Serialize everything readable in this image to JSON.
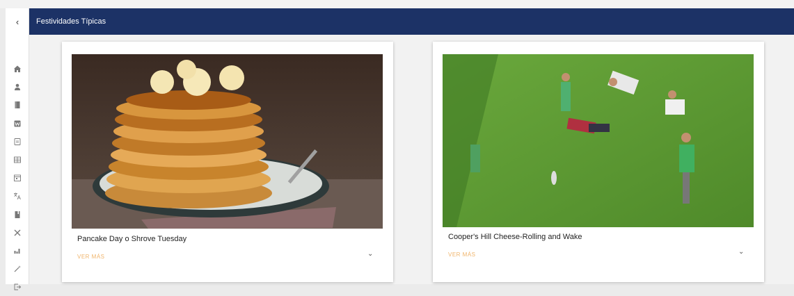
{
  "app": {
    "title": "Festividades Típicas"
  },
  "sidebar": {
    "collapse_icon": "‹",
    "items": [
      {
        "name": "home-icon"
      },
      {
        "name": "user-icon"
      },
      {
        "name": "book-icon"
      },
      {
        "name": "word-icon"
      },
      {
        "name": "document-icon"
      },
      {
        "name": "table-icon"
      },
      {
        "name": "calendar-icon"
      },
      {
        "name": "translate-icon"
      },
      {
        "name": "notebook-icon"
      },
      {
        "name": "tools-icon"
      },
      {
        "name": "chart-icon"
      },
      {
        "name": "magic-wand-icon"
      },
      {
        "name": "logout-icon"
      }
    ]
  },
  "cards": [
    {
      "title": "Pancake Day o Shrove Tuesday",
      "more_label": "VER MÁS",
      "chevron": "⌄"
    },
    {
      "title": "Cooper's Hill Cheese-Rolling and Wake",
      "more_label": "VER MÁS",
      "chevron": "⌄"
    }
  ],
  "colors": {
    "header": "#1c3266",
    "accent": "#f0b46a"
  }
}
